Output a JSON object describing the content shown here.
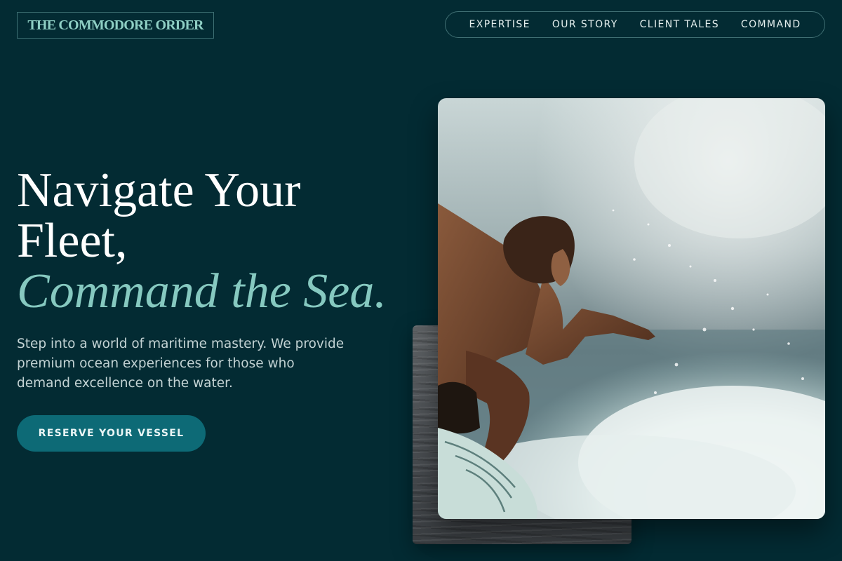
{
  "brand": {
    "name": "THE COMMODORE ORDER"
  },
  "nav": {
    "items": [
      {
        "label": "EXPERTISE"
      },
      {
        "label": "OUR STORY"
      },
      {
        "label": "CLIENT TALES"
      },
      {
        "label": "COMMAND"
      }
    ]
  },
  "hero": {
    "headline_line1": "Navigate Your",
    "headline_line2": "Fleet,",
    "headline_accent": "Command the Sea.",
    "subtext": "Step into a world of maritime mastery. We provide premium ocean experiences for those who demand excellence on the water.",
    "cta_label": "RESERVE YOUR VESSEL"
  },
  "images": {
    "main": "surfer-riding-wave-photo",
    "secondary": "ocean-water-surface-photo"
  },
  "colors": {
    "background": "#032b33",
    "accent": "#86c9c0",
    "button": "#0d6a76"
  }
}
